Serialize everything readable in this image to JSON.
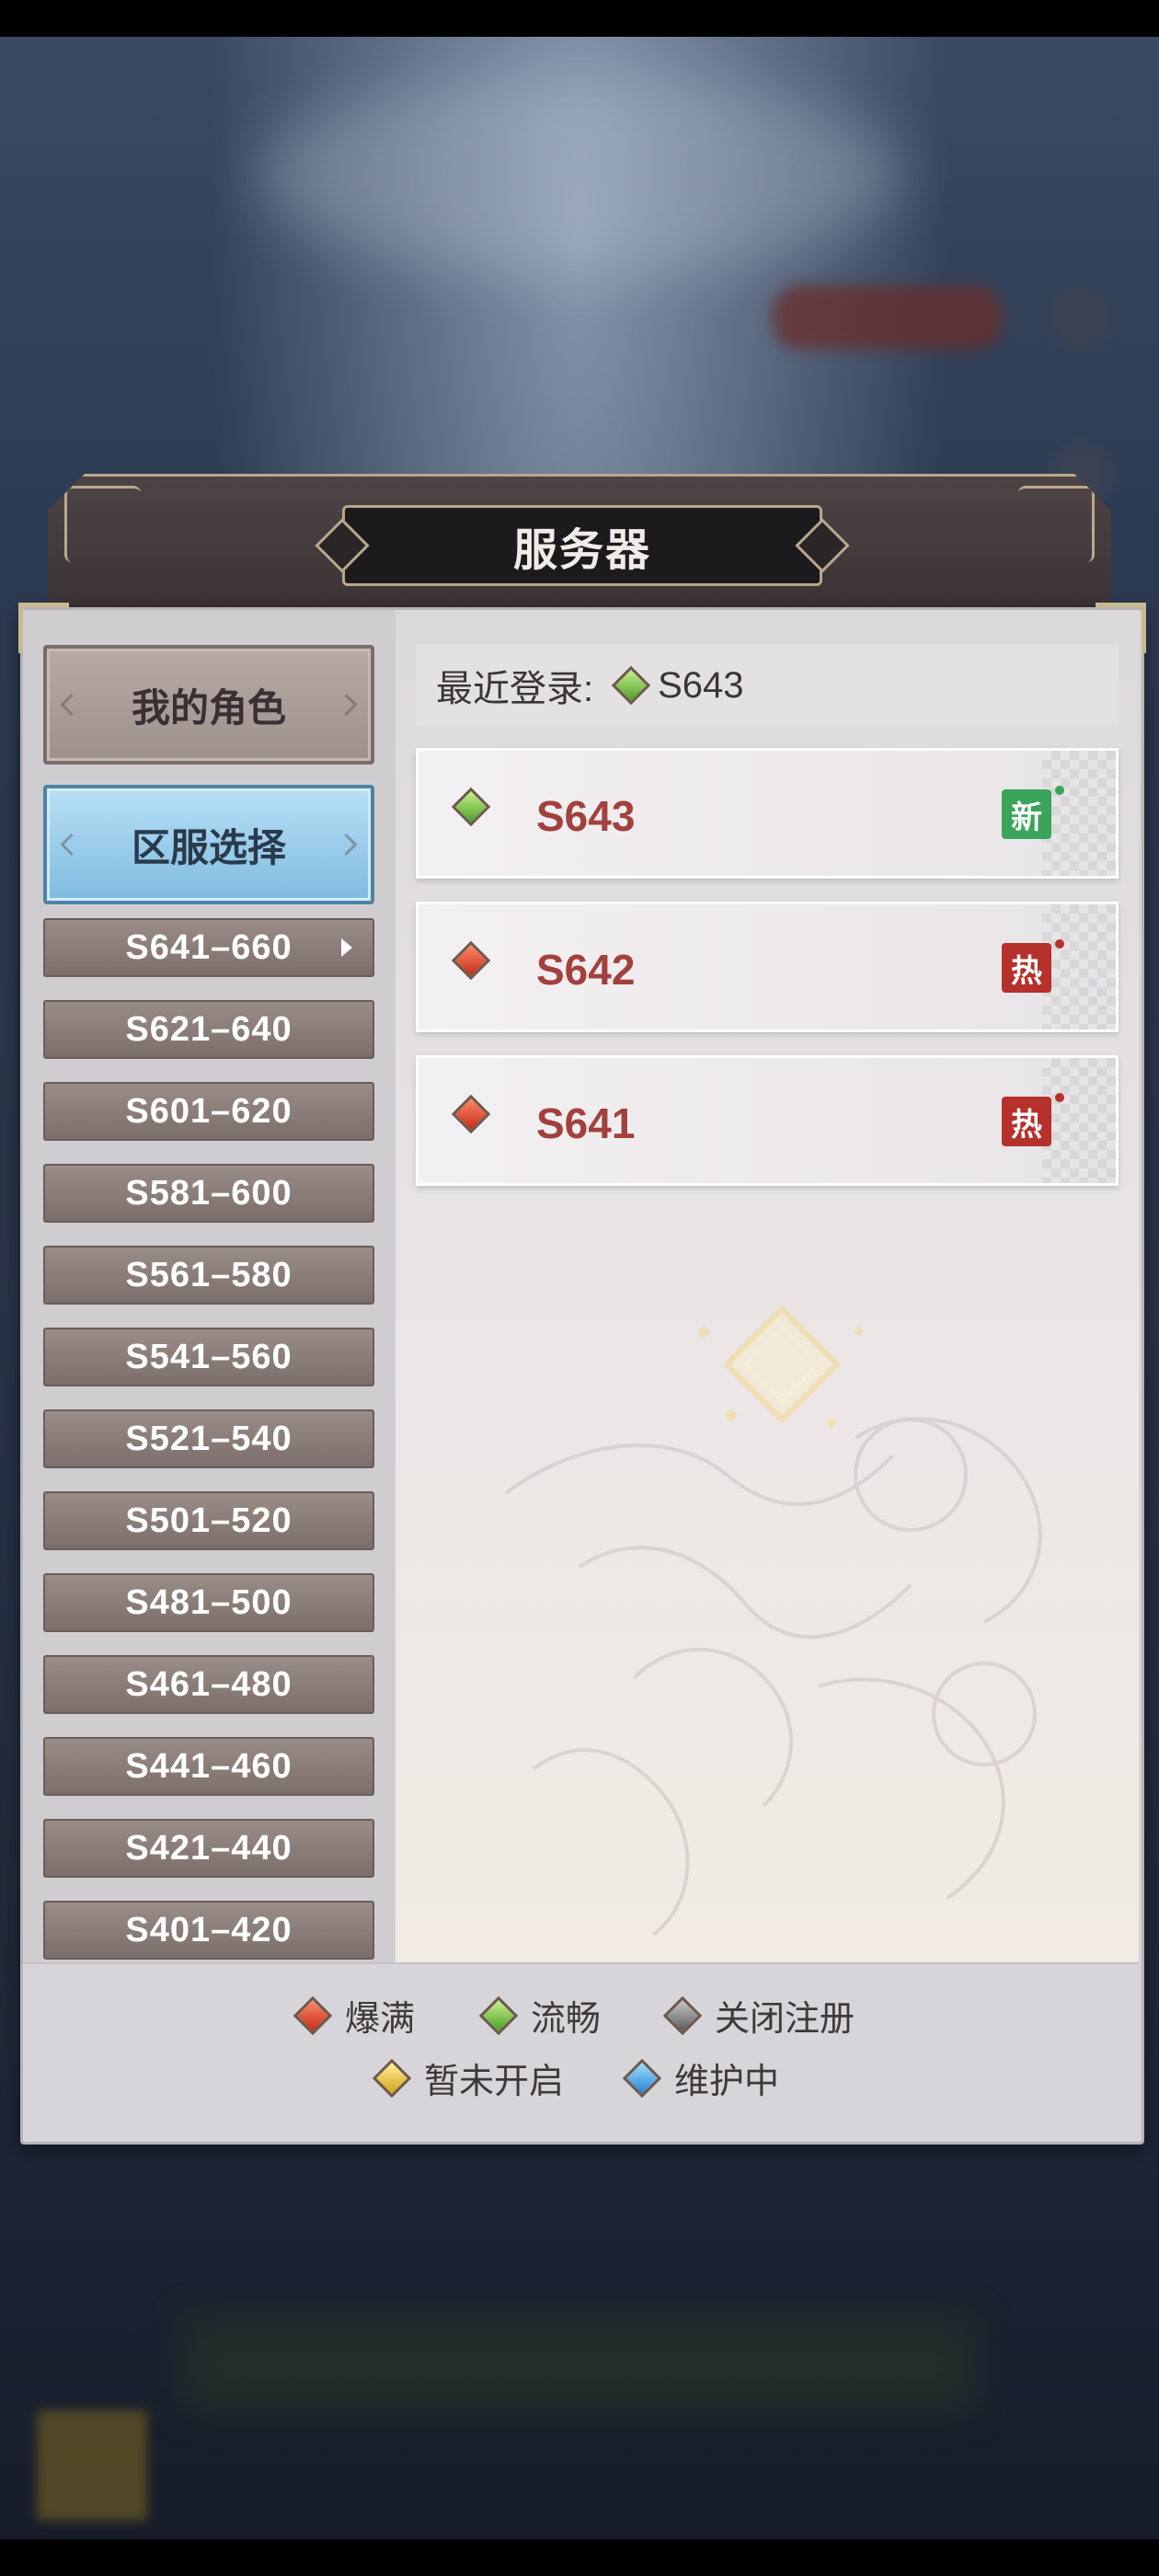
{
  "dialog": {
    "title": "服务器"
  },
  "sidebar": {
    "my_role": "我的角色",
    "region_select": "区服选择",
    "ranges": [
      "S641–660",
      "S621–640",
      "S601–620",
      "S581–600",
      "S561–580",
      "S541–560",
      "S521–540",
      "S501–520",
      "S481–500",
      "S461–480",
      "S441–460",
      "S421–440",
      "S401–420"
    ]
  },
  "recent": {
    "label": "最近登录:",
    "server": "S643",
    "gem_color": "green"
  },
  "servers": [
    {
      "name": "S643",
      "status": "green",
      "tag": "新",
      "tag_type": "new"
    },
    {
      "name": "S642",
      "status": "red",
      "tag": "热",
      "tag_type": "hot"
    },
    {
      "name": "S641",
      "status": "red",
      "tag": "热",
      "tag_type": "hot"
    }
  ],
  "legend": [
    {
      "label": "爆满",
      "color": "red"
    },
    {
      "label": "流畅",
      "color": "green"
    },
    {
      "label": "关闭注册",
      "color": "gray"
    },
    {
      "label": "暂未开启",
      "color": "yellow"
    },
    {
      "label": "维护中",
      "color": "blue"
    }
  ],
  "colors": {
    "server_name": "#a2403e",
    "range_button": "#8a7c78",
    "region_select_active": "#9ccfee",
    "tag_new": "#3aa45a",
    "tag_hot": "#b6302c"
  }
}
